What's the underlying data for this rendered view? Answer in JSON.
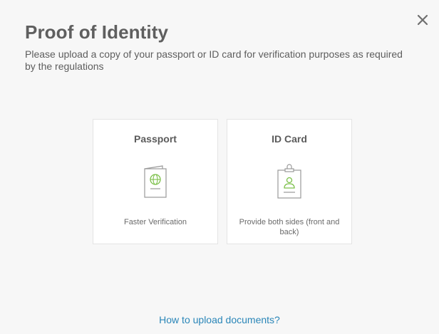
{
  "modal": {
    "title": "Proof of Identity",
    "subtitle": "Please upload a copy of your passport or ID card for verification purposes as required by the regulations",
    "close_icon": "close-icon"
  },
  "options": {
    "passport": {
      "label": "Passport",
      "description": "Faster Verification",
      "icon": "passport-icon"
    },
    "id_card": {
      "label": "ID Card",
      "description": "Provide both sides (front and back)",
      "icon": "id-card-icon"
    }
  },
  "footer": {
    "help_link": "How to upload documents?"
  },
  "colors": {
    "accent_green": "#7cc04a",
    "link_blue": "#2a86b8",
    "icon_gray": "#9a9a9a"
  }
}
